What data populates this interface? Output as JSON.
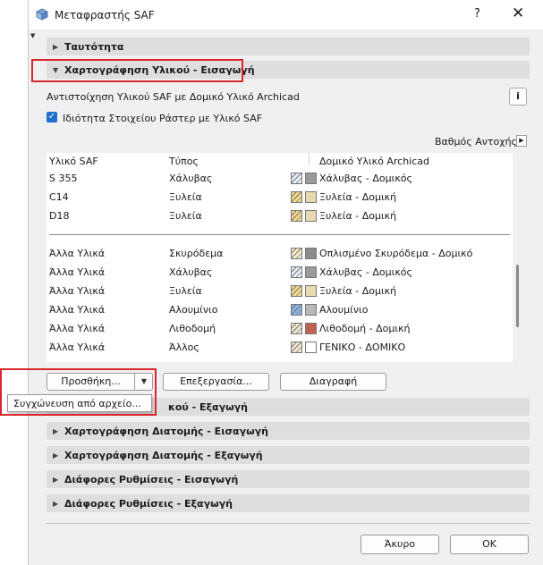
{
  "window": {
    "title": "Μεταφραστής SAF",
    "help_label": "?",
    "close_label": "✕"
  },
  "sections": {
    "identity": "Ταυτότητα",
    "material_import": "Χαρτογράφηση Υλικού - Εισαγωγή",
    "material_export_partial": "κού - Εξαγωγή",
    "section_import": "Χαρτογράφηση Διατομής - Εισαγωγή",
    "section_export": "Χαρτογράφηση Διατομής - Εξαγωγή",
    "misc_import": "Διάφορες Ρυθμίσεις - Εισαγωγή",
    "misc_export": "Διάφορες Ρυθμίσεις - Εξαγωγή"
  },
  "material_panel": {
    "description": "Αντιστοίχηση Υλικού SAF με Δομικό Υλικό Archicad",
    "checkbox_label": "Ιδιότητα Στοιχείου Ράστερ με Υλικό SAF",
    "checkbox_checked": true,
    "info_label": "i",
    "grade_label": "Βαθμός Αντοχής",
    "columns": [
      "Υλικό SAF",
      "Τύπος",
      "Δομικό Υλικό Archicad"
    ],
    "rows": [
      {
        "saf": "S 355",
        "type": "Χάλυβας",
        "archicad": "Χάλυβας - Δομικός",
        "fill": "#e6eef8",
        "surface": "#9a9a9a"
      },
      {
        "saf": "C14",
        "type": "Ξυλεία",
        "archicad": "Ξυλεία - Δομική",
        "fill": "#f2d98a",
        "surface": "#e8d9b0"
      },
      {
        "saf": "D18",
        "type": "Ξυλεία",
        "archicad": "Ξυλεία - Δομική",
        "fill": "#f2d98a",
        "surface": "#e8d9b0"
      }
    ],
    "other_rows": [
      {
        "saf": "Άλλα Υλικά",
        "type": "Σκυρόδεμα",
        "archicad": "Οπλισμένο Σκυρόδεμα - Δομικό",
        "fill": "#f5ecc8",
        "surface": "#8c8c8c"
      },
      {
        "saf": "Άλλα Υλικά",
        "type": "Χάλυβας",
        "archicad": "Χάλυβας - Δομικός",
        "fill": "#e6eef8",
        "surface": "#9a9a9a"
      },
      {
        "saf": "Άλλα Υλικά",
        "type": "Ξυλεία",
        "archicad": "Ξυλεία - Δομική",
        "fill": "#f2d98a",
        "surface": "#e8d9b0"
      },
      {
        "saf": "Άλλα Υλικά",
        "type": "Αλουμίνιο",
        "archicad": "Αλουμίνιο",
        "fill": "#8ab4e8",
        "surface": "#b8b8b8"
      },
      {
        "saf": "Άλλα Υλικά",
        "type": "Λιθοδομή",
        "archicad": "Λιθοδομή - Δομική",
        "fill": "#eee6d0",
        "surface": "#c0604e"
      },
      {
        "saf": "Άλλα Υλικά",
        "type": "Άλλος",
        "archicad": "ΓΕΝΙΚΟ - ΔΟΜΙΚΟ",
        "fill": "#f2e8cc",
        "surface": "#ffffff"
      }
    ]
  },
  "buttons": {
    "add": "Προσθήκη...",
    "edit": "Επεξεργασία...",
    "delete": "Διαγραφή",
    "cancel": "Άκυρο",
    "ok": "ΟΚ"
  },
  "add_menu": {
    "item": "Συγχώνευση από αρχείο..."
  },
  "colors": {
    "highlight": "#d9262a",
    "accent": "#1f6fd0"
  }
}
